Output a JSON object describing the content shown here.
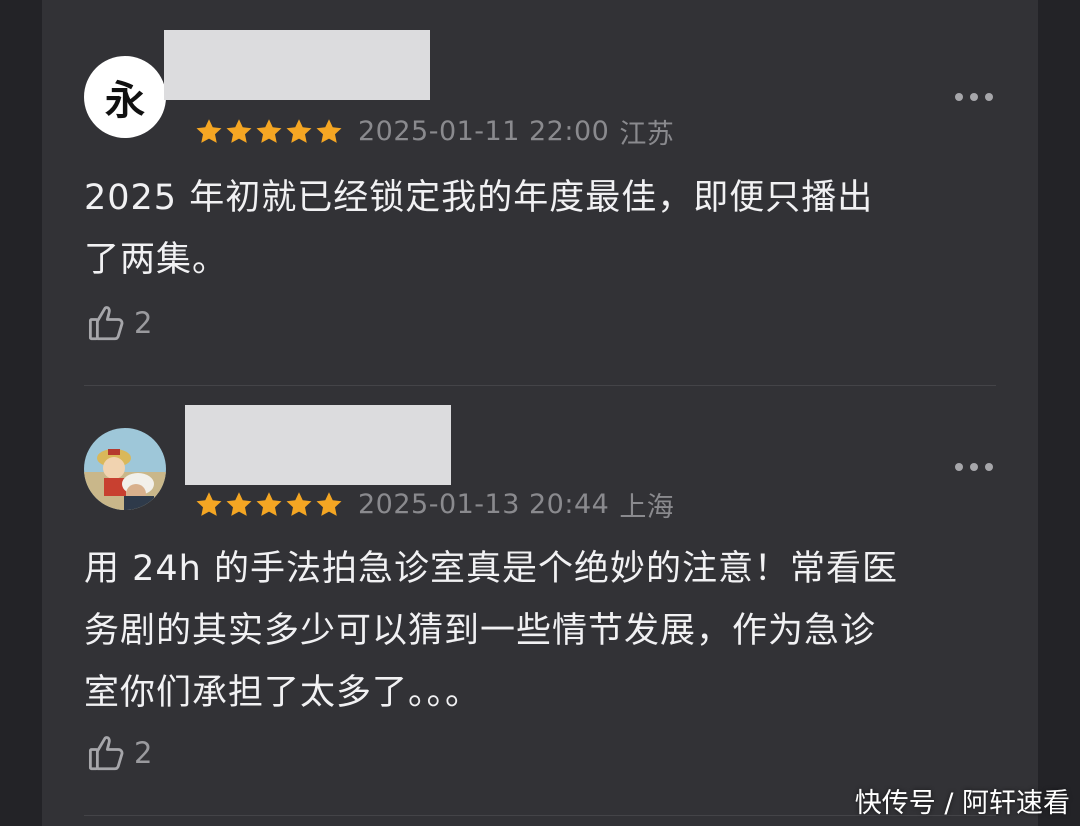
{
  "comments": [
    {
      "avatar_text": "永",
      "avatar_desc": "calligraphy-avatar",
      "rating": 5,
      "timestamp": "2025-01-11 22:00",
      "location": "江苏",
      "text_lines": [
        "2025 年初就已经锁定我的年度最佳，即便只播出",
        "了两集。"
      ],
      "likes": "2"
    },
    {
      "avatar_desc": "anime-avatar",
      "rating": 5,
      "timestamp": "2025-01-13 20:44",
      "location": "上海",
      "text_lines": [
        "用 24h 的手法拍急诊室真是个绝妙的注意！常看医",
        "务剧的其实多少可以猜到一些情节发展，作为急诊",
        "室你们承担了太多了。。。"
      ],
      "likes": "2"
    }
  ],
  "watermark": "快传号 / 阿轩速看",
  "colors": {
    "star": "#f5a623",
    "panel": "#323236",
    "text": "#f1f1f3",
    "meta": "#8a8a8e"
  }
}
